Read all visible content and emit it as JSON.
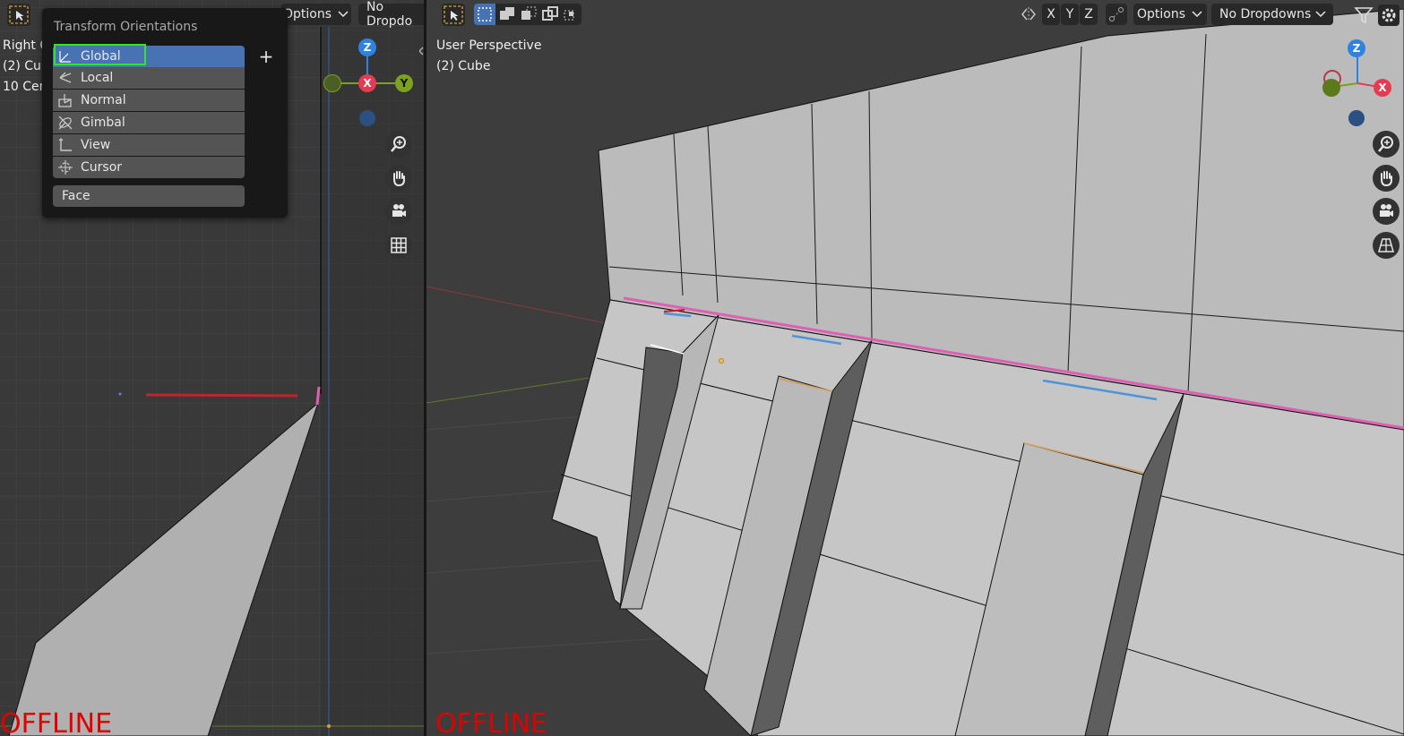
{
  "left_viewport": {
    "overlay_lines": [
      "Right O",
      "(2) Cub",
      "10 Cen"
    ],
    "header": {
      "options_label": "Options",
      "dropdown_label": "No Dropdo"
    },
    "offline_label": "OFFLINE",
    "gizmo": {
      "z": "Z",
      "x": "X",
      "y": "Y"
    }
  },
  "transform_menu": {
    "title": "Transform Orientations",
    "items": [
      {
        "label": "Global",
        "icon": "global-orientation-icon",
        "active": true
      },
      {
        "label": "Local",
        "icon": "local-orientation-icon",
        "active": false
      },
      {
        "label": "Normal",
        "icon": "normal-orientation-icon",
        "active": false
      },
      {
        "label": "Gimbal",
        "icon": "gimbal-orientation-icon",
        "active": false
      },
      {
        "label": "View",
        "icon": "view-orientation-icon",
        "active": false
      },
      {
        "label": "Cursor",
        "icon": "cursor-orientation-icon",
        "active": false
      }
    ],
    "add_label": "+",
    "name_field_value": "Face"
  },
  "right_viewport": {
    "overlay_title": "User Perspective",
    "overlay_object": "(2) Cube",
    "header": {
      "axis_x": "X",
      "axis_y": "Y",
      "axis_z": "Z",
      "options_label": "Options",
      "dropdown_label": "No Dropdowns"
    },
    "offline_label": "OFFLINE",
    "gizmo": {
      "z": "Z",
      "x": "X"
    }
  },
  "colors": {
    "active_item": "#4772b3",
    "highlight_border": "#35e22c",
    "offline_text": "#e00000",
    "axis_x": "#e53a52",
    "axis_y": "#7ca11f",
    "axis_z": "#2f83e0",
    "selected_edge": "#df5fb4"
  }
}
